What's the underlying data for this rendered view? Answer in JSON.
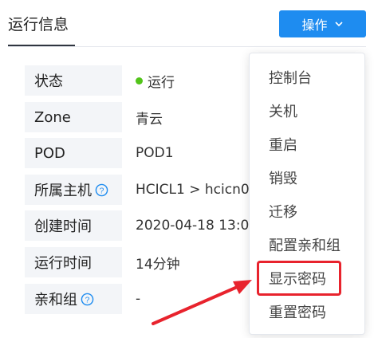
{
  "header": {
    "title": "运行信息",
    "ops_button_label": "操作"
  },
  "info": [
    {
      "label": "状态",
      "value": "运行",
      "status_color": "#52c41a"
    },
    {
      "label": "Zone",
      "value": "青云"
    },
    {
      "label": "POD",
      "value": "POD1"
    },
    {
      "label": "所属主机",
      "value": "HCICL1 > hcicn0",
      "help": true
    },
    {
      "label": "创建时间",
      "value": "2020-04-18 13:0"
    },
    {
      "label": "运行时间",
      "value": "14分钟"
    },
    {
      "label": "亲和组",
      "value": "-",
      "help": true
    }
  ],
  "dropdown": {
    "items": [
      "控制台",
      "关机",
      "重启",
      "销毁",
      "迁移",
      "配置亲和组",
      "显示密码",
      "重置密码"
    ],
    "highlighted": "显示密码"
  },
  "colors": {
    "primary": "#1e8cf0",
    "annotation": "#e8232d",
    "status_running": "#52c41a"
  }
}
